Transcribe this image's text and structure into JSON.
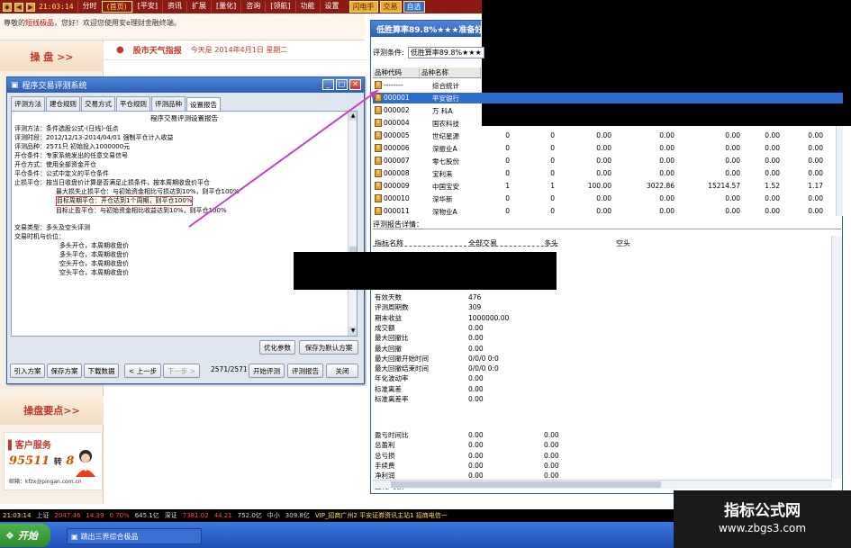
{
  "topbar": {
    "clock": "21:03:14",
    "menu": [
      "分时",
      "(首页)",
      "[平安]",
      "资讯",
      "扩展",
      "[量化]",
      "咨询",
      "[领航]",
      "功能",
      "设置"
    ],
    "shortcuts": [
      "闪电手",
      "交易",
      "自选"
    ]
  },
  "welcome": {
    "prefix": "尊敬的",
    "name": "短线极品",
    "suffix": "，您好！欢迎您使用安e理财金融终端。"
  },
  "left_panel": {
    "header1": "操 盘 >>",
    "header2": "操盘要点>>",
    "cs_title": "客户服务",
    "cs_phone_main": "95511",
    "cs_phone_sep": "转",
    "cs_phone_ext": "8",
    "cs_mail": "邮箱：kfzx@pingan.com.cn"
  },
  "weather": {
    "dot": "●",
    "title": "股市天气指报",
    "date": "今天是 2014年4月1日 星期二"
  },
  "eval_dialog": {
    "title": "程序交易评测系统",
    "tabs": [
      "评测方法",
      "建仓规则",
      "交易方式",
      "平仓规则",
      "评测品种",
      "设置报告"
    ],
    "active_tab": "设置报告",
    "report_title": "程序交易评测设置报告",
    "lines": [
      "评测方法：条件选股公式-(日线)-低点",
      "评测时段：2012/12/13-2014/04/01 强制平仓计入收益",
      "评测品种：2571只 初始投入1000000元",
      "开仓条件：专家系统发出的任意交易信号",
      "开仓方式：使用全部资金开仓",
      "平仓条件：公式中定义的平仓条件",
      "止损平仓：按当日收盘价计算是否满足止损条件，按本周期收盘价平仓"
    ],
    "stop_lines": [
      "最大损失止损平仓：与初始资金相比亏损达到10%，则平仓100%",
      "目标周期平仓：开仓达到1个周期，则平仓100%",
      "目标止盈平仓：与初始资金相比收益达到10%，则平仓100%"
    ],
    "trade_type": "交易类型：多头及空头评测",
    "trade_timing": "交易时机与价位：",
    "timing_lines": [
      "多头开仓，本周期收盘价",
      "多头平仓，本周期收盘价",
      "空头开仓，本周期收盘价",
      "空头平仓，本周期收盘价"
    ],
    "btn_optimize": "优化参数",
    "btn_save_default": "保存为默认方案",
    "btn_import": "引入方案",
    "btn_save_plan": "保存方案",
    "btn_download": "下载数据",
    "btn_prev": "< 上一步",
    "btn_next": "下一步 >",
    "progress": "2571/2571",
    "btn_start": "开始评测",
    "btn_report": "评测报告",
    "btn_close": "关闭"
  },
  "result_window": {
    "title": "低胜算率89.8%★★★准备好",
    "cond_label": "评测条件:",
    "cond_value": "低胜算率89.8%★★★",
    "grid_headers": [
      "品种代码",
      "品种名称"
    ],
    "rows": [
      {
        "code": "--------",
        "name": "综合统计",
        "vals": []
      },
      {
        "code": "000001",
        "name": "平安银行",
        "vals": []
      },
      {
        "code": "000002",
        "name": "万 科A",
        "vals": []
      },
      {
        "code": "000004",
        "name": "国农科技",
        "vals": []
      },
      {
        "code": "000005",
        "name": "世纪星源",
        "vals": [
          "0",
          "0",
          "0.00",
          "0.00",
          "0.00",
          "0.00",
          "0.00"
        ]
      },
      {
        "code": "000006",
        "name": "深振业A",
        "vals": [
          "0",
          "0",
          "0.00",
          "0.00",
          "0.00",
          "0.00",
          "0.00"
        ]
      },
      {
        "code": "000007",
        "name": "零七股份",
        "vals": [
          "0",
          "0",
          "0.00",
          "0.00",
          "0.00",
          "0.00",
          "0.00"
        ]
      },
      {
        "code": "000008",
        "name": "宝利来",
        "vals": [
          "0",
          "0",
          "0.00",
          "0.00",
          "0.00",
          "0.00",
          "0.00"
        ]
      },
      {
        "code": "000009",
        "name": "中国宝安",
        "vals": [
          "1",
          "1",
          "100.00",
          "3022.86",
          "15214.57",
          "1.52",
          "1.17"
        ]
      },
      {
        "code": "000010",
        "name": "深华新",
        "vals": [
          "0",
          "0",
          "0.00",
          "0.00",
          "0.00",
          "0.00",
          "0.00"
        ]
      },
      {
        "code": "000011",
        "name": "深物业A",
        "vals": [
          "0",
          "0",
          "0.00",
          "0.00",
          "0.00",
          "0.00",
          "0.00"
        ]
      }
    ],
    "detail_label": "评测报告详情：",
    "detail_headers": [
      "指标名称",
      "全部交易",
      "多头",
      "空头"
    ],
    "details_top": [
      {
        "k": "有效天数",
        "v": "476"
      },
      {
        "k": "评测周期数",
        "v": "309"
      },
      {
        "k": "期末收益",
        "v": "1000000.00"
      },
      {
        "k": "成交额",
        "v": "0.00"
      },
      {
        "k": "最大回撤比",
        "v": "0.00"
      },
      {
        "k": "最大回撤",
        "v": "0.00"
      },
      {
        "k": "最大回撤开始时间",
        "v": "0/0/0 0:0"
      },
      {
        "k": "最大回撤结束时间",
        "v": "0/0/0 0:0"
      },
      {
        "k": "年化波动率",
        "v": "0.00"
      },
      {
        "k": "标准离差",
        "v": "0.00"
      },
      {
        "k": "标准离差率",
        "v": "0.00"
      }
    ],
    "details_bottom": [
      {
        "k": "盈亏时间比",
        "v1": "0.00",
        "v2": "0.00"
      },
      {
        "k": "总盈利",
        "v1": "0.00",
        "v2": "0.00"
      },
      {
        "k": "总亏损",
        "v1": "0.00",
        "v2": "0.00"
      },
      {
        "k": "手续费",
        "v1": "0.00",
        "v2": "0.00"
      },
      {
        "k": "净利润",
        "v1": "0.00",
        "v2": "0.00"
      },
      {
        "k": "盈利/亏损",
        "v1": "0.00",
        "v2": "0.00"
      }
    ]
  },
  "watermark": {
    "line1": "指标公式网",
    "line2": "www.zbgs3.com"
  },
  "ticker": {
    "time": "21:03:14",
    "idx1": "上证",
    "val1": "2047.46",
    "chg1": "14.39",
    "pct1": "0.70%",
    "amt1": "645.1亿",
    "idx2": "深证",
    "val2": "7381.02",
    "chg2": "44.21",
    "amt2": "752.0亿",
    "idx3": "中小",
    "amt3": "309.8亿",
    "news": "VIP_招商广州2 平安证券资讯主站1 招商电信一"
  },
  "taskbar": {
    "start": "开始",
    "item": "跳出三界综合极品"
  }
}
